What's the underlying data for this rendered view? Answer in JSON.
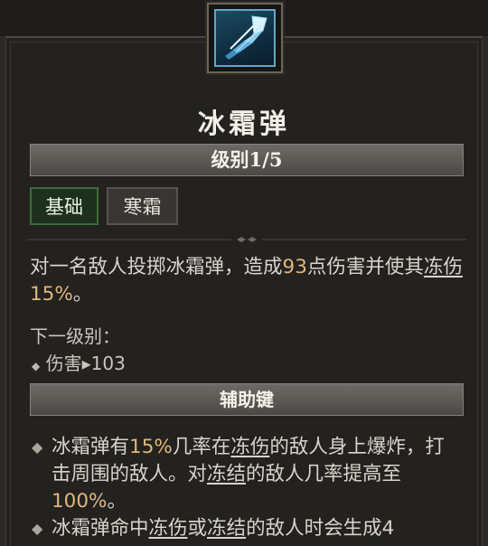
{
  "skill": {
    "name": "冰霜弹",
    "level_label": "级别1/5",
    "icon": "frost-bolt-icon"
  },
  "tabs": [
    "基础",
    "寒霜"
  ],
  "description": {
    "p1": "对一名敌人投掷冰霜弹，造成",
    "damage": "93",
    "p2": "点伤害并使其",
    "chill_term": "冻伤",
    "chill_value": "15%",
    "p3": "。"
  },
  "next_level": {
    "label": "下一级别：",
    "stat_name": "伤害",
    "arrow": "▸",
    "stat_value": "103"
  },
  "auxiliary": {
    "title": "辅助键",
    "item1": {
      "skill": "冰霜弹",
      "t1": "有",
      "chance": "15%",
      "t2": "几率在",
      "term1": "冻伤",
      "t3": "的敌人身上爆炸，打击周围的敌人。对",
      "term2": "冻结",
      "t4": "的敌人几率提高至",
      "value2": "100%",
      "t5": "。"
    },
    "item2": {
      "skill": "冰霜弹",
      "t1": "命中",
      "term1": "冻伤",
      "t2": "或",
      "term2": "冻结",
      "t3": "的敌人时会生成4"
    }
  },
  "colors": {
    "highlight": "#e0b77b",
    "text": "#d7d4cc",
    "panel": "#23221f",
    "active_tab": "#1d301f"
  }
}
